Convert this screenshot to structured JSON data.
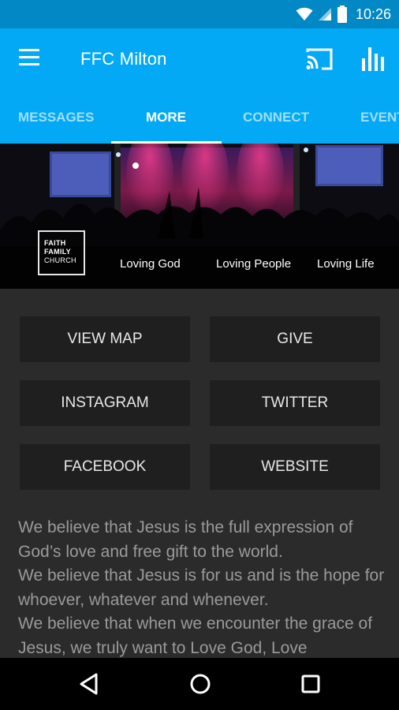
{
  "status_bar": {
    "time": "10:26",
    "icons": [
      "wifi-icon",
      "signal-icon",
      "battery-icon"
    ],
    "color": "#0288c4"
  },
  "app_bar": {
    "title": "FFC Milton",
    "color": "#03a9f4",
    "icons": [
      "menu-icon",
      "cast-icon",
      "bar-chart-icon"
    ]
  },
  "tabs": [
    {
      "label": "MESSAGES",
      "active": false
    },
    {
      "label": "MORE",
      "active": true
    },
    {
      "label": "CONNECT",
      "active": false
    },
    {
      "label": "EVENTS",
      "active": false
    }
  ],
  "banner": {
    "logo_lines": [
      "FAITH",
      "FAMILY",
      "CHURCH"
    ],
    "taglines": [
      "Loving God",
      "Loving People",
      "Loving Life"
    ]
  },
  "buttons": [
    {
      "label": "VIEW MAP"
    },
    {
      "label": "GIVE"
    },
    {
      "label": "INSTAGRAM"
    },
    {
      "label": "TWITTER"
    },
    {
      "label": "FACEBOOK"
    },
    {
      "label": "WEBSITE"
    }
  ],
  "description": [
    "We believe that Jesus is the full expression of God’s love and free gift to the world.",
    "We believe that Jesus is for us and is the hope for whoever, whatever and whenever.",
    "We believe that when we encounter the grace of Jesus, we truly want to Love God, Love"
  ],
  "nav_bar": {
    "icons": [
      "back-icon",
      "home-icon",
      "recents-icon"
    ]
  }
}
